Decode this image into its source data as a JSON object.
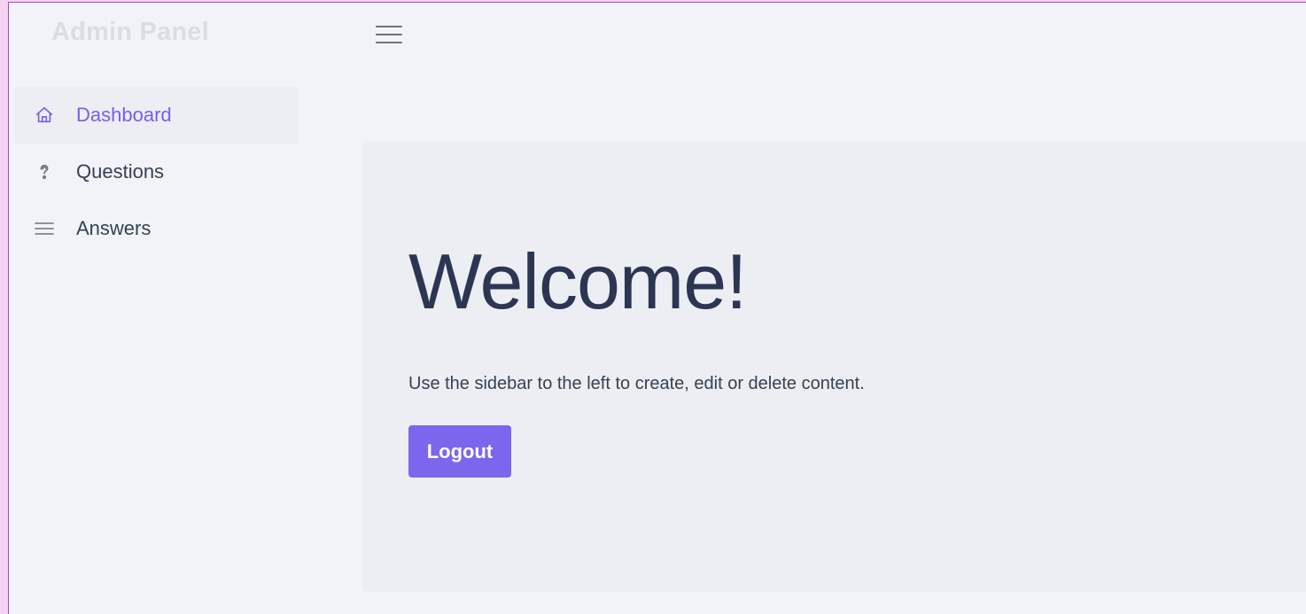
{
  "app": {
    "brand": "Admin Panel"
  },
  "sidebar": {
    "items": [
      {
        "label": "Dashboard",
        "icon": "home-icon",
        "active": true
      },
      {
        "label": "Questions",
        "icon": "question-icon",
        "active": false
      },
      {
        "label": "Answers",
        "icon": "list-icon",
        "active": false
      }
    ]
  },
  "main": {
    "heading": "Welcome!",
    "lead": "Use the sidebar to the left to create, edit or delete content.",
    "logout_label": "Logout"
  },
  "colors": {
    "accent": "#7c66ee",
    "active_nav_text": "#7c5cf0",
    "background": "#f1f3f8",
    "card": "#eceef3",
    "heading": "#2c3653"
  }
}
